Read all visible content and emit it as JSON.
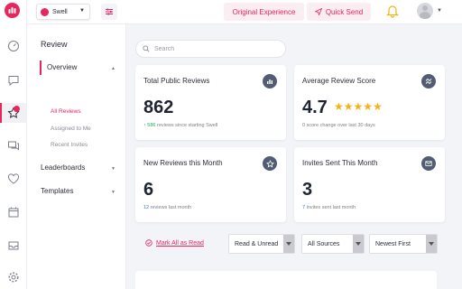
{
  "colors": {
    "accent": "#e8265e",
    "icon_bg": "#525c73",
    "star": "#f4b315",
    "positive": "#29a35a",
    "link_blue": "#3a78c2"
  },
  "rail": {
    "logo_icon": "swell-logo-icon",
    "items": [
      {
        "icon": "dashboard-gauge-icon"
      },
      {
        "icon": "chat-bubble-icon"
      },
      {
        "icon": "star-icon",
        "active": true
      },
      {
        "icon": "messages-icon"
      },
      {
        "icon": "heart-icon"
      },
      {
        "icon": "calendar-icon"
      },
      {
        "icon": "inbox-icon"
      },
      {
        "icon": "gear-icon"
      }
    ]
  },
  "topbar": {
    "brand_select_value": "Swell",
    "original_experience_label": "Original Experience",
    "quick_send_label": "Quick Send"
  },
  "subnav": {
    "title": "Review",
    "overview_label": "Overview",
    "overview_items": [
      "All Reviews",
      "Assigned to Me",
      "Recent Invites"
    ],
    "leaderboards_label": "Leaderboards",
    "templates_label": "Templates"
  },
  "search": {
    "placeholder": "Search"
  },
  "cards": {
    "total_public": {
      "title": "Total Public Reviews",
      "value": "862",
      "note_count": "586",
      "note_text": "reviews since starting Swell",
      "icon": "bar-chart-icon"
    },
    "average_score": {
      "title": "Average Review Score",
      "value": "4.7",
      "stars": 5,
      "note_text": "0 score change over last 30 days",
      "icon": "trend-arrows-icon"
    },
    "new_reviews": {
      "title": "New Reviews this Month",
      "value": "6",
      "note_count": "12",
      "note_text": "reviews last month",
      "icon": "star-badge-icon"
    },
    "invites_sent": {
      "title": "Invites Sent This Month",
      "value": "3",
      "note_count": "7",
      "note_text": "invites sent last month",
      "icon": "envelope-icon"
    }
  },
  "actions": {
    "mark_all_read": "Mark All as Read"
  },
  "filters": {
    "read_state": "Read & Unread",
    "sources": "All Sources",
    "sort": "Newest First"
  }
}
